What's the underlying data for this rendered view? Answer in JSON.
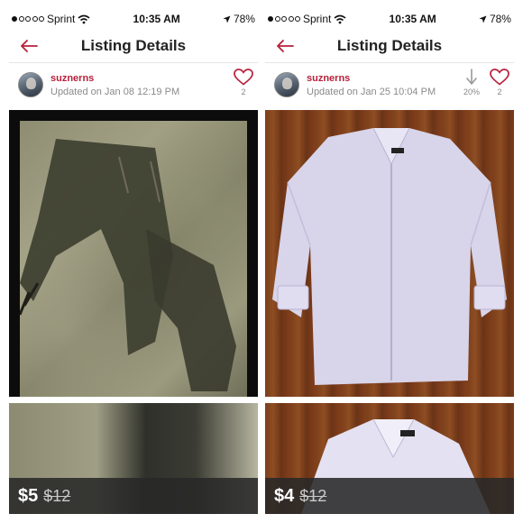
{
  "colors": {
    "accent": "#b7203a",
    "price_bar": "#282828",
    "muted_text": "#8a8a8a"
  },
  "panels": [
    {
      "status": {
        "carrier": "Sprint",
        "time": "10:35 AM",
        "battery": "78%"
      },
      "nav": {
        "title": "Listing Details",
        "back_icon": "back-arrow-icon"
      },
      "user": {
        "name": "suznerns",
        "updated": "Updated on Jan 08 12:19 PM"
      },
      "likes": {
        "count": "2",
        "icon": "heart-icon"
      },
      "photo_main": "Dark cargo capri pants on a bedspread",
      "photo_secondary": "Close-up of cargo capri pants",
      "price": {
        "current": "$5",
        "original": "$12"
      }
    },
    {
      "status": {
        "carrier": "Sprint",
        "time": "10:35 AM",
        "battery": "78%"
      },
      "nav": {
        "title": "Listing Details",
        "back_icon": "back-arrow-icon"
      },
      "user": {
        "name": "suznerns",
        "updated": "Updated on Jan 25 10:04 PM"
      },
      "price_drop": {
        "percent": "20%",
        "icon": "price-drop-arrow-icon"
      },
      "likes": {
        "count": "2",
        "icon": "heart-icon"
      },
      "photo_main": "Lavender button-up shirt on a wood floor",
      "photo_secondary": "Close-up of lavender shirt collar",
      "price": {
        "current": "$4",
        "original": "$12"
      }
    }
  ]
}
